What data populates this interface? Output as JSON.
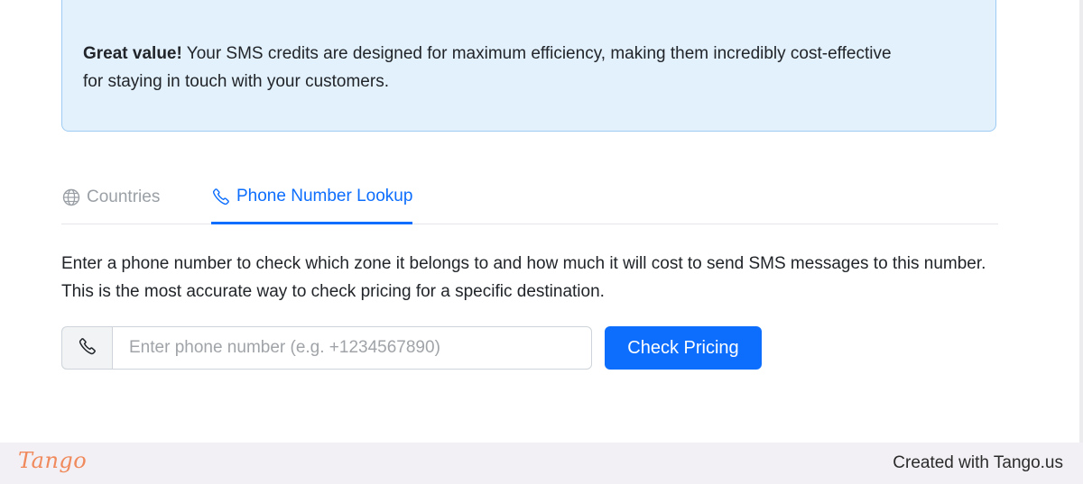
{
  "info_box": {
    "bold_lead": "Great value!",
    "text": " Your SMS credits are designed for maximum efficiency, making them incredibly cost-effective for staying in touch with your customers."
  },
  "tabs": [
    {
      "label": "Countries",
      "icon": "globe-icon",
      "active": false
    },
    {
      "label": "Phone Number Lookup",
      "icon": "phone-icon",
      "active": true
    }
  ],
  "lookup": {
    "description": "Enter a phone number to check which zone it belongs to and how much it will cost to send SMS messages to this number. This is the most accurate way to check pricing for a specific destination.",
    "input_placeholder": "Enter phone number (e.g. +1234567890)",
    "input_value": "",
    "prefix_icon": "phone-icon",
    "button_label": "Check Pricing"
  },
  "footer": {
    "logo_text": "Tango",
    "credit": "Created with Tango.us"
  },
  "colors": {
    "accent": "#0d6efd",
    "info_bg": "#e3f1fd",
    "info_border": "#9ecbf3",
    "tango": "#f08a5d"
  }
}
